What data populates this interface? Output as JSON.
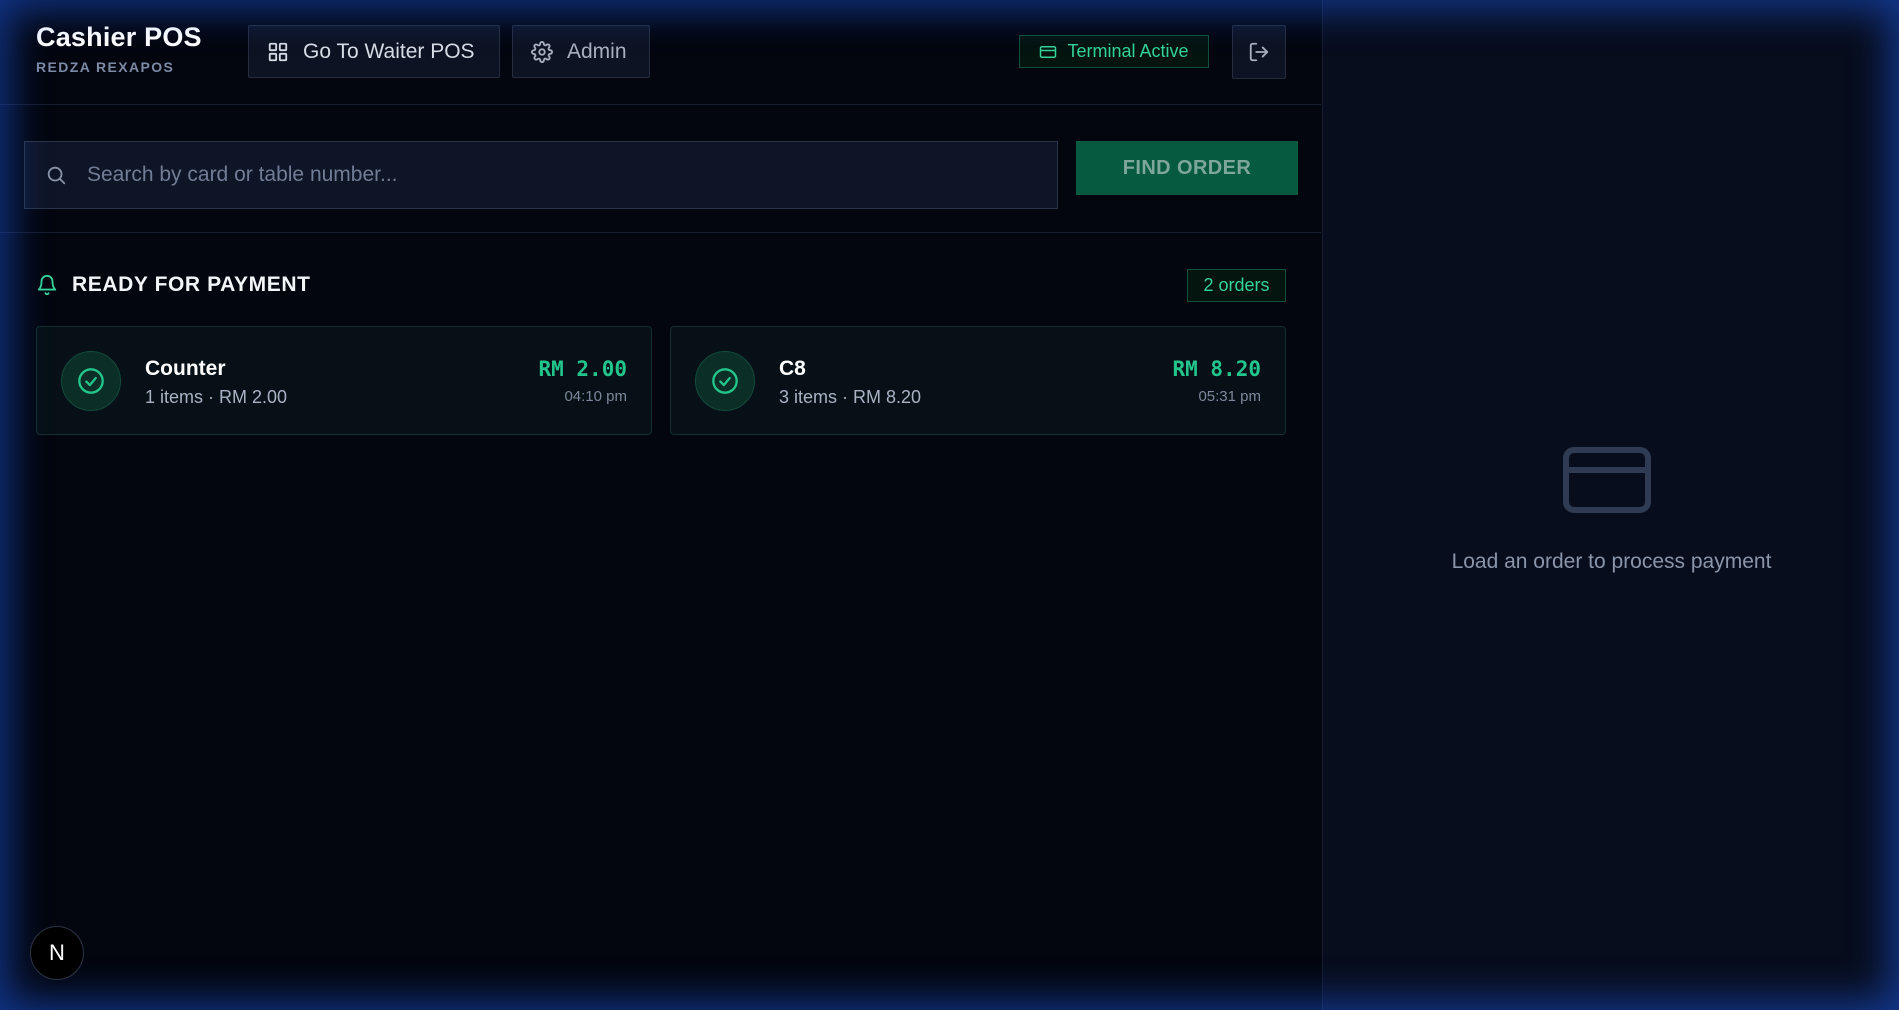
{
  "header": {
    "title": "Cashier POS",
    "subtitle": "REDZA REXAPOS",
    "waiter_button_label": "Go To Waiter POS",
    "admin_button_label": "Admin",
    "terminal_status": "Terminal Active"
  },
  "search": {
    "placeholder": "Search by card or table number...",
    "value": "",
    "find_button_label": "FIND ORDER"
  },
  "ready": {
    "title": "READY FOR PAYMENT",
    "count_label": "2 orders",
    "orders": [
      {
        "name": "Counter",
        "meta": "1 items · RM 2.00",
        "amount": "RM 2.00",
        "time": "04:10 pm"
      },
      {
        "name": "C8",
        "meta": "3 items · RM 8.20",
        "amount": "RM 8.20",
        "time": "05:31 pm"
      }
    ]
  },
  "detail": {
    "empty_text": "Load an order to process payment"
  },
  "next_badge": {
    "label": "N"
  },
  "colors": {
    "accent": "#34d399",
    "amount": "#22c58b",
    "find_button": "#055a40",
    "background": "#03060f",
    "glow": "#1e5ae6"
  },
  "icons": {
    "waiter": "grid-icon",
    "admin": "gear-icon",
    "terminal": "credit-card-icon",
    "logout": "logout-icon",
    "search": "search-icon",
    "ready": "bell-icon",
    "order_status": "check-circle-icon",
    "empty_state": "credit-card-icon"
  }
}
